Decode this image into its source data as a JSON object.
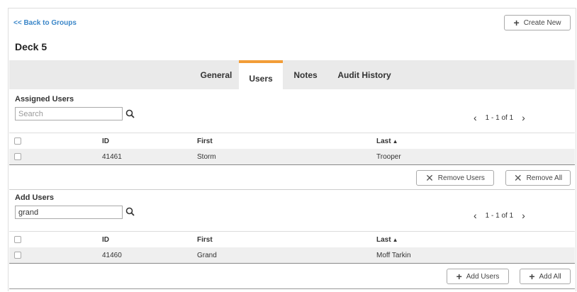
{
  "back_link": "<< Back to Groups",
  "create_new": "Create New",
  "page_title": "Deck 5",
  "tabs": [
    {
      "label": "General",
      "active": false
    },
    {
      "label": "Users",
      "active": true
    },
    {
      "label": "Notes",
      "active": false
    },
    {
      "label": "Audit History",
      "active": false
    }
  ],
  "assigned": {
    "title": "Assigned Users",
    "search_placeholder": "Search",
    "search_value": "",
    "pager_text": "1 - 1 of 1",
    "columns": [
      "ID",
      "First",
      "Last"
    ],
    "rows": [
      {
        "id": "41461",
        "first": "Storm",
        "last": "Trooper"
      }
    ],
    "remove_users": "Remove Users",
    "remove_all": "Remove All"
  },
  "add": {
    "title": "Add Users",
    "search_value": "grand",
    "pager_text": "1 - 1 of 1",
    "columns": [
      "ID",
      "First",
      "Last"
    ],
    "rows": [
      {
        "id": "41460",
        "first": "Grand",
        "last": "Moff Tarkin"
      }
    ],
    "add_users": "Add Users",
    "add_all": "Add All"
  },
  "colors": {
    "accent_tab": "#f29d38",
    "link": "#3a86c8",
    "tabbar_bg": "#eaeaea"
  },
  "icons": [
    "plus-icon",
    "search-icon",
    "chevron-left-icon",
    "chevron-right-icon",
    "close-icon",
    "sort-asc-icon"
  ]
}
